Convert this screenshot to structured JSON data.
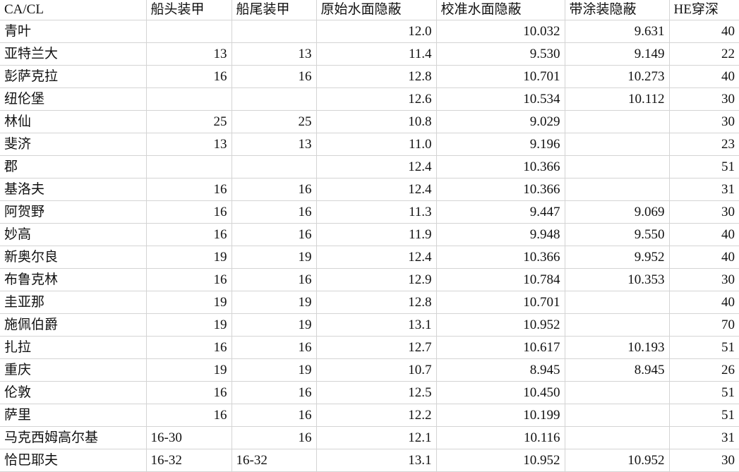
{
  "spreadsheet": {
    "selection_marker_color": "#107c41",
    "gridline_color": "#d4d4d4",
    "selected_row_index": 19
  },
  "columns": [
    {
      "key": "name",
      "label": "CA/CL",
      "align": "left"
    },
    {
      "key": "bow_armor",
      "label": "船头装甲",
      "align": "right"
    },
    {
      "key": "stern_armor",
      "label": "船尾装甲",
      "align": "right"
    },
    {
      "key": "base_conceal",
      "label": "原始水面隐蔽",
      "align": "right"
    },
    {
      "key": "calib_conceal",
      "label": "校准水面隐蔽",
      "align": "right"
    },
    {
      "key": "camo_conceal",
      "label": "带涂装隐蔽",
      "align": "right"
    },
    {
      "key": "he_pen",
      "label": "HE穿深",
      "align": "right"
    }
  ],
  "rows": [
    {
      "name": "青叶",
      "bow_armor": "",
      "stern_armor": "",
      "base_conceal": "12.0",
      "calib_conceal": "10.032",
      "camo_conceal": "9.631",
      "he_pen": "40"
    },
    {
      "name": "亚特兰大",
      "bow_armor": "13",
      "stern_armor": "13",
      "base_conceal": "11.4",
      "calib_conceal": "9.530",
      "camo_conceal": "9.149",
      "he_pen": "22"
    },
    {
      "name": "彭萨克拉",
      "bow_armor": "16",
      "stern_armor": "16",
      "base_conceal": "12.8",
      "calib_conceal": "10.701",
      "camo_conceal": "10.273",
      "he_pen": "40"
    },
    {
      "name": "纽伦堡",
      "bow_armor": "",
      "stern_armor": "",
      "base_conceal": "12.6",
      "calib_conceal": "10.534",
      "camo_conceal": "10.112",
      "he_pen": "30"
    },
    {
      "name": "林仙",
      "bow_armor": "25",
      "stern_armor": "25",
      "base_conceal": "10.8",
      "calib_conceal": "9.029",
      "camo_conceal": "",
      "he_pen": "30"
    },
    {
      "name": "斐济",
      "bow_armor": "13",
      "stern_armor": "13",
      "base_conceal": "11.0",
      "calib_conceal": "9.196",
      "camo_conceal": "",
      "he_pen": "23"
    },
    {
      "name": "郡",
      "bow_armor": "",
      "stern_armor": "",
      "base_conceal": "12.4",
      "calib_conceal": "10.366",
      "camo_conceal": "",
      "he_pen": "51"
    },
    {
      "name": "基洛夫",
      "bow_armor": "16",
      "stern_armor": "16",
      "base_conceal": "12.4",
      "calib_conceal": "10.366",
      "camo_conceal": "",
      "he_pen": "31"
    },
    {
      "name": "阿贺野",
      "bow_armor": "16",
      "stern_armor": "16",
      "base_conceal": "11.3",
      "calib_conceal": "9.447",
      "camo_conceal": "9.069",
      "he_pen": "30"
    },
    {
      "name": "妙高",
      "bow_armor": "16",
      "stern_armor": "16",
      "base_conceal": "11.9",
      "calib_conceal": "9.948",
      "camo_conceal": "9.550",
      "he_pen": "40"
    },
    {
      "name": "新奥尔良",
      "bow_armor": "19",
      "stern_armor": "19",
      "base_conceal": "12.4",
      "calib_conceal": "10.366",
      "camo_conceal": "9.952",
      "he_pen": "40"
    },
    {
      "name": "布鲁克林",
      "bow_armor": "16",
      "stern_armor": "16",
      "base_conceal": "12.9",
      "calib_conceal": "10.784",
      "camo_conceal": "10.353",
      "he_pen": "30"
    },
    {
      "name": "圭亚那",
      "bow_armor": "19",
      "stern_armor": "19",
      "base_conceal": "12.8",
      "calib_conceal": "10.701",
      "camo_conceal": "",
      "he_pen": "40"
    },
    {
      "name": "施佩伯爵",
      "bow_armor": "19",
      "stern_armor": "19",
      "base_conceal": "13.1",
      "calib_conceal": "10.952",
      "camo_conceal": "",
      "he_pen": "70"
    },
    {
      "name": "扎拉",
      "bow_armor": "16",
      "stern_armor": "16",
      "base_conceal": "12.7",
      "calib_conceal": "10.617",
      "camo_conceal": "10.193",
      "he_pen": "51"
    },
    {
      "name": "重庆",
      "bow_armor": "19",
      "stern_armor": "19",
      "base_conceal": "10.7",
      "calib_conceal": "8.945",
      "camo_conceal": "8.945",
      "he_pen": "26"
    },
    {
      "name": "伦敦",
      "bow_armor": "16",
      "stern_armor": "16",
      "base_conceal": "12.5",
      "calib_conceal": "10.450",
      "camo_conceal": "",
      "he_pen": "51"
    },
    {
      "name": "萨里",
      "bow_armor": "16",
      "stern_armor": "16",
      "base_conceal": "12.2",
      "calib_conceal": "10.199",
      "camo_conceal": "",
      "he_pen": "51"
    },
    {
      "name": "马克西姆高尔基",
      "bow_armor": "16-30",
      "stern_armor": "16",
      "base_conceal": "12.1",
      "calib_conceal": "10.116",
      "camo_conceal": "",
      "he_pen": "31"
    },
    {
      "name": "恰巴耶夫",
      "bow_armor": "16-32",
      "stern_armor": "16-32",
      "base_conceal": "13.1",
      "calib_conceal": "10.952",
      "camo_conceal": "10.952",
      "he_pen": "30"
    }
  ]
}
